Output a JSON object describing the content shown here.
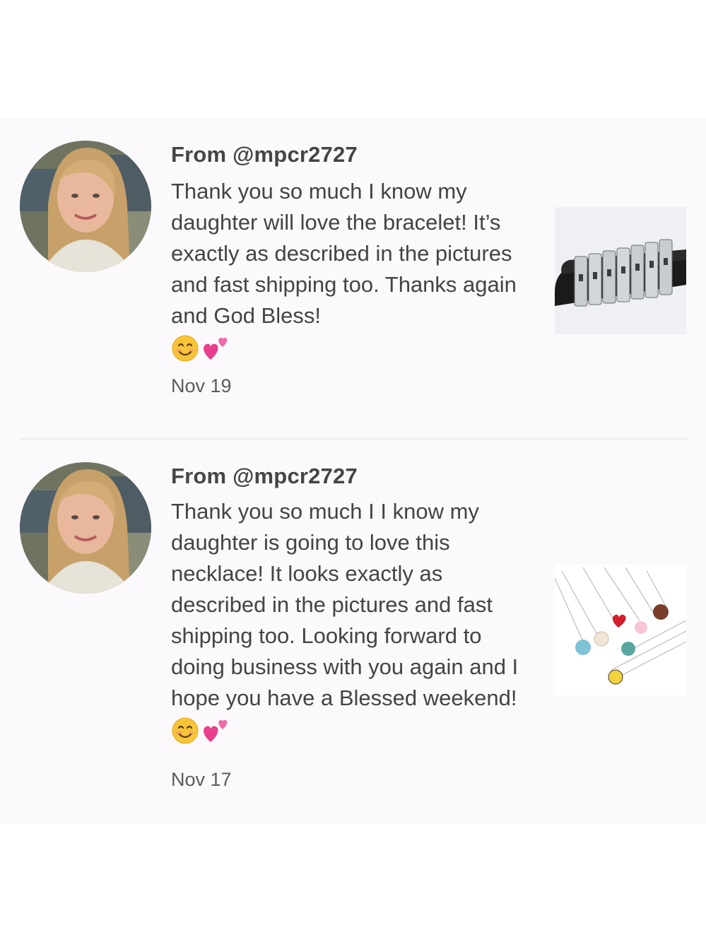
{
  "reviews": [
    {
      "sender": "From @mpcr2727",
      "message": "Thank you so much I know my daughter will love the bracelet! It’s exactly as described in the pictures and fast shipping too. Thanks again and God Bless!",
      "emoji": [
        "smiling-face-icon",
        "two-hearts-icon"
      ],
      "date": "Nov 19",
      "product": "bracelet-photo"
    },
    {
      "sender": "From @mpcr2727",
      "message": "Thank you so much I I know my daughter is going to love this necklace! It looks exactly as described in the pictures and fast shipping too. Looking forward to doing business with you again and I hope you have a Blessed weekend!",
      "emoji": [
        "smiling-face-icon",
        "two-hearts-icon"
      ],
      "date": "Nov 17",
      "product": "necklace-photo"
    }
  ],
  "colors": {
    "panel_background": "#fbf9fb",
    "text": "#444444",
    "divider": "#ecebec",
    "heart": "#e8408c",
    "smile": "#f7c43a"
  }
}
